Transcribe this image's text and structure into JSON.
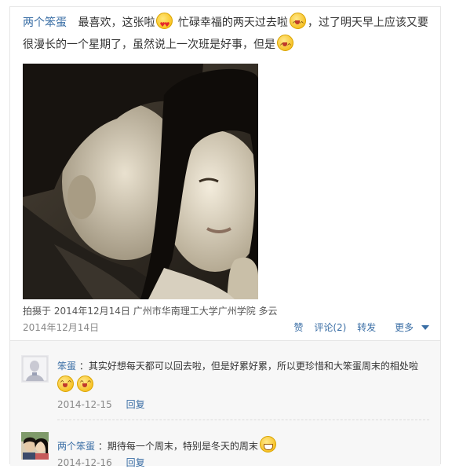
{
  "post": {
    "author": "两个笨蛋",
    "text_1": "最喜欢，这张啦",
    "text_2": "忙碌幸福的两天过去啦",
    "text_3": "，过了明天早上应该又要很漫长的一个星期了，虽然说上一次班是好事，但是",
    "emoticons": [
      "love-face",
      "happy-face",
      "happy-face"
    ],
    "photo_meta": "拍摄于 2014年12月14日  广州市华南理工大学广州学院 多云",
    "date": "2014年12月14日",
    "actions": {
      "like": "赞",
      "comment": "评论(2)",
      "share": "转发",
      "more": "更多"
    }
  },
  "comments": [
    {
      "author": "笨蛋",
      "text": "：其实好想每天都可以回去啦，但是好累好累，所以更珍惜和大笨蛋周末的相处啦",
      "emoticons": [
        "happy-face",
        "happy-face"
      ],
      "date": "2014-12-15",
      "reply": "回复"
    },
    {
      "author": "两个笨蛋",
      "text": "：期待每一个周末，特别是冬天的周末",
      "emoticons": [
        "grin-face"
      ],
      "date": "2014-12-16",
      "reply": "回复"
    }
  ]
}
